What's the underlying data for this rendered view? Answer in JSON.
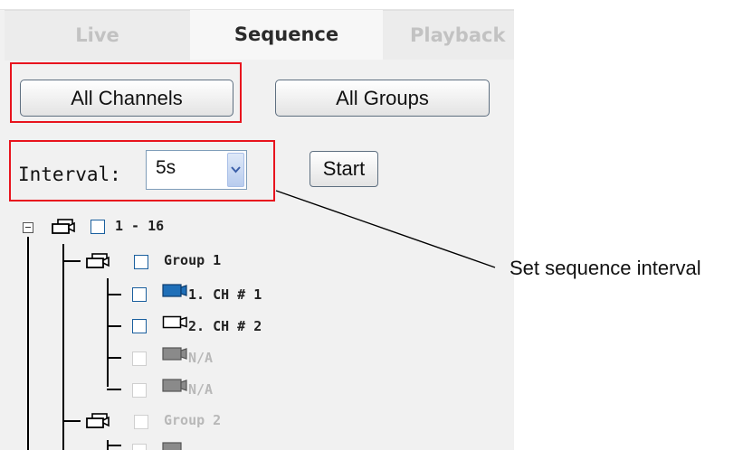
{
  "tabs": [
    {
      "label": "Live",
      "state": "inactive"
    },
    {
      "label": "Sequence",
      "state": "active"
    },
    {
      "label": "Playback",
      "state": "inactive"
    }
  ],
  "buttons": {
    "all_channels": "All Channels",
    "all_groups": "All Groups",
    "start": "Start"
  },
  "interval": {
    "label": "Interval:",
    "value": "5s"
  },
  "tree": {
    "root": {
      "label": "1 - 16",
      "icon": "camera-group-icon"
    },
    "group1": {
      "label": "Group 1",
      "icon": "camera-group-icon"
    },
    "channels": [
      {
        "label": "1. CH # 1",
        "icon": "camera-blue-icon",
        "enabled": true
      },
      {
        "label": "2. CH # 2",
        "icon": "camera-white-icon",
        "enabled": true
      },
      {
        "label": "N/A",
        "icon": "camera-gray-icon",
        "enabled": false
      },
      {
        "label": "N/A",
        "icon": "camera-gray-icon",
        "enabled": false
      }
    ],
    "group2": {
      "label": "Group 2",
      "icon": "camera-group-icon",
      "enabled": false
    }
  },
  "annotation": {
    "text": "Set sequence interval"
  },
  "colors": {
    "highlight_box": "#e8141e",
    "camera_active": "#1f6fb8",
    "camera_disabled": "#8a8a8a"
  }
}
